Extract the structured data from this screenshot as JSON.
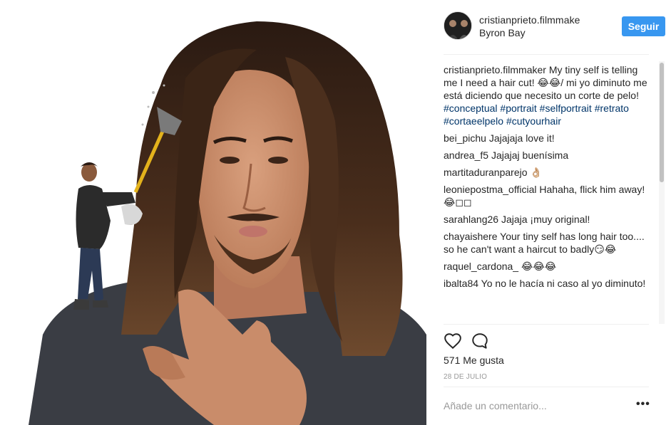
{
  "post": {
    "username": "cristianprieto.filmmake",
    "location": "Byron Bay",
    "follow_label": "Seguir",
    "likes": "571 Me gusta",
    "date": "28 DE JULIO",
    "comment_placeholder": "Añade un comentario...",
    "more_label": "•••"
  },
  "caption": {
    "author": "cristianprieto.filmmaker",
    "text": " My tiny self is telling me I need a hair cut! 😂😂/ mi yo diminuto me está diciendo que necesito un corte de pelo! ",
    "hashtags": [
      "#conceptual",
      "#portrait",
      "#selfportrait",
      "#retrato",
      "#cortaeelpelo",
      "#cutyourhair"
    ]
  },
  "comments": [
    {
      "author": "bei_pichu",
      "text": " Jajajaja love it!"
    },
    {
      "author": "andrea_f5",
      "text": " Jajajaj buenísima"
    },
    {
      "author": "martitaduranparejo",
      "text": " 👌🏼"
    },
    {
      "author": "leoniepostma_official",
      "text": " Hahaha, flick him away! 😂◻◻"
    },
    {
      "author": "sarahlang26",
      "text": " Jajaja ¡muy original!"
    },
    {
      "author": "chayaishere",
      "text": " Your tiny self has long hair too.... so he can't want a haircut to badly😏😂"
    },
    {
      "author": "raquel_cardona_",
      "text": " 😂😂😂"
    },
    {
      "author": "ibalta84",
      "text": " Yo no le hacía ni caso al yo diminuto!"
    }
  ],
  "icons": {
    "like": "heart-icon",
    "comment": "comment-bubble-icon"
  },
  "colors": {
    "follow_button": "#3897f0",
    "hashtag": "#003569",
    "muted": "#999999"
  }
}
